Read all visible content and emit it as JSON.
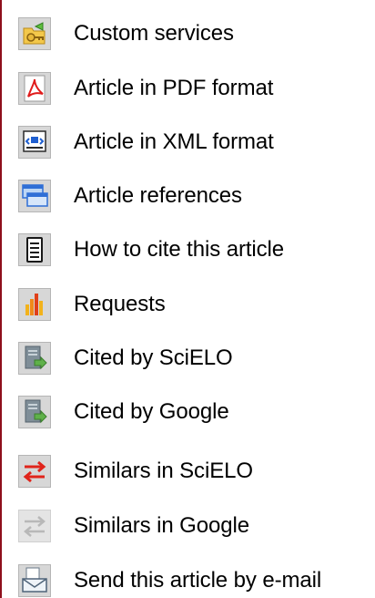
{
  "menu": {
    "items": [
      {
        "label": "Custom services",
        "icon": "key-folder-icon"
      },
      {
        "label": "Article in PDF format",
        "icon": "pdf-icon"
      },
      {
        "label": "Article in XML format",
        "icon": "xml-document-icon"
      },
      {
        "label": "Article references",
        "icon": "references-icon"
      },
      {
        "label": "How to cite this article",
        "icon": "cite-document-icon"
      },
      {
        "label": "Requests",
        "icon": "bar-chart-icon"
      },
      {
        "label": "Cited by SciELO",
        "icon": "cited-document-icon"
      },
      {
        "label": "Cited by Google",
        "icon": "cited-document-icon"
      },
      {
        "label": "Similars in SciELO",
        "icon": "red-arrows-icon"
      },
      {
        "label": "Similars in Google",
        "icon": "gray-arrows-icon"
      },
      {
        "label": "Send this article by e-mail",
        "icon": "email-icon"
      }
    ]
  },
  "colors": {
    "left_rule": "#8e0f1c",
    "text": "#000000"
  }
}
